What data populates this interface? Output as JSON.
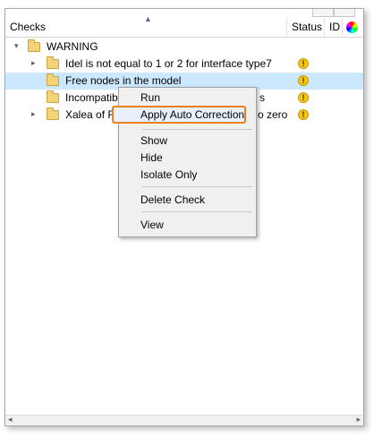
{
  "header": {
    "col_checks": "Checks",
    "col_status": "Status",
    "col_id": "ID",
    "color_icon": "color-wheel-icon"
  },
  "tree": {
    "group": {
      "label": "WARNING",
      "expander": "▾",
      "icon": "folder-icon"
    },
    "items": [
      {
        "label": "Idel is not equal to 1 or 2 for interface type7",
        "expander": "▸",
        "status": "!"
      },
      {
        "label": "Free nodes in the model",
        "expander": "",
        "status": "!",
        "selected": true
      },
      {
        "label": "Incompatible",
        "label_tail": "s",
        "expander": "",
        "status": "!"
      },
      {
        "label": "Xalea of Ra",
        "label_tail": "o zero",
        "expander": "▸",
        "status": "!"
      }
    ],
    "status_color": "#f5c518"
  },
  "context_menu": {
    "run": "Run",
    "apply_auto_correction": "Apply Auto Correction",
    "show": "Show",
    "hide": "Hide",
    "isolate_only": "Isolate Only",
    "delete_check": "Delete Check",
    "view": "View",
    "highlight_color": "#e8821c"
  },
  "scrollbar": {
    "left_arrow": "◂",
    "right_arrow": "▸"
  }
}
